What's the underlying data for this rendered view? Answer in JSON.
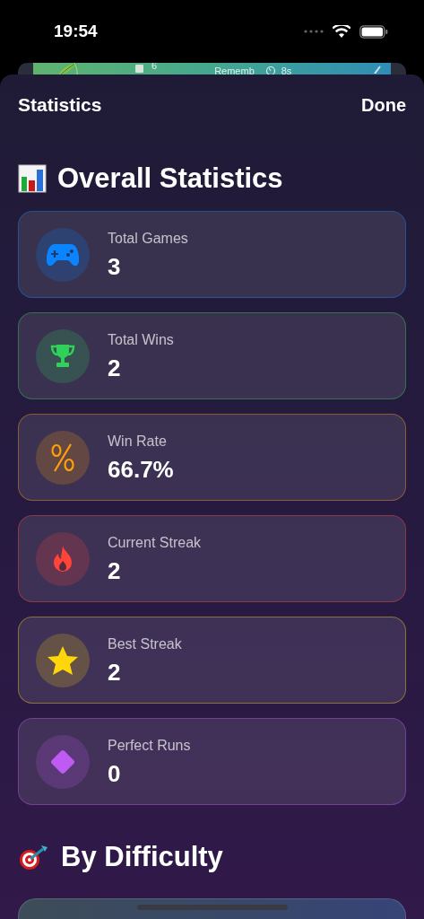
{
  "status_bar": {
    "time": "19:54"
  },
  "background_card": {
    "count": "6",
    "title": "Rememb",
    "time": "8s"
  },
  "sheet": {
    "title": "Statistics",
    "done": "Done"
  },
  "overall": {
    "title": "Overall Statistics",
    "stats": [
      {
        "label": "Total Games",
        "value": "3",
        "kind": "gamepad",
        "color": "#0a84ff"
      },
      {
        "label": "Total Wins",
        "value": "2",
        "kind": "trophy",
        "color": "#30d158"
      },
      {
        "label": "Win Rate",
        "value": "66.7%",
        "kind": "percent",
        "color": "#ff9f0a"
      },
      {
        "label": "Current Streak",
        "value": "2",
        "kind": "flame",
        "color": "#ff453a"
      },
      {
        "label": "Best Streak",
        "value": "2",
        "kind": "star",
        "color": "#ffd60a"
      },
      {
        "label": "Perfect Runs",
        "value": "0",
        "kind": "diamond",
        "color": "#bf5af2"
      }
    ]
  },
  "by_difficulty": {
    "title": "By Difficulty"
  }
}
